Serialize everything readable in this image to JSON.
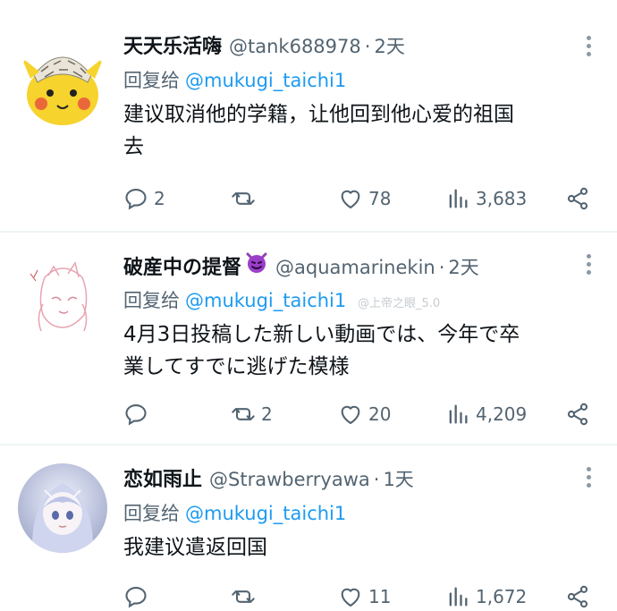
{
  "tweets": [
    {
      "display_name": "天天乐活嗨",
      "handle": "@tank688978",
      "separator": "·",
      "time": "2天",
      "reply_prefix": "回复给",
      "reply_to": "@mukugi_taichi1",
      "text_lines": [
        "建议取消他的学籍，让他回到他心爱的祖国",
        "去"
      ],
      "replies": "2",
      "retweets": "",
      "likes": "78",
      "views": "3,683",
      "avatar": "pikachu-hat-avatar",
      "has_emoji": false
    },
    {
      "display_name": "破産中の提督",
      "handle": "@aquamarinekin",
      "separator": "·",
      "time": "2天",
      "reply_prefix": "回复给",
      "reply_to": "@mukugi_taichi1",
      "text_lines": [
        "4月3日投稿した新しい動画では、今年で卒",
        "業してすでに逃げた模様"
      ],
      "replies": "",
      "retweets": "2",
      "likes": "20",
      "views": "4,209",
      "avatar": "anime-sketch-avatar",
      "has_emoji": true,
      "emoji": "smiling-devil-emoji"
    },
    {
      "display_name": "恋如雨止",
      "handle": "@Strawberryawa",
      "separator": "·",
      "time": "1天",
      "reply_prefix": "回复给",
      "reply_to": "@mukugi_taichi1",
      "text_lines": [
        "我建议遣返回国"
      ],
      "replies": "",
      "retweets": "",
      "likes": "11",
      "views": "1,672",
      "avatar": "anime-girl-avatar",
      "has_emoji": false
    }
  ],
  "watermark": "@上帝之眼_5.0",
  "colors": {
    "text": "#0f1419",
    "secondary": "#536471",
    "link": "#1d9bf0",
    "divider": "#eff3f4"
  },
  "icons": [
    "reply-icon",
    "retweet-icon",
    "like-icon",
    "views-icon",
    "share-icon",
    "more-icon"
  ]
}
